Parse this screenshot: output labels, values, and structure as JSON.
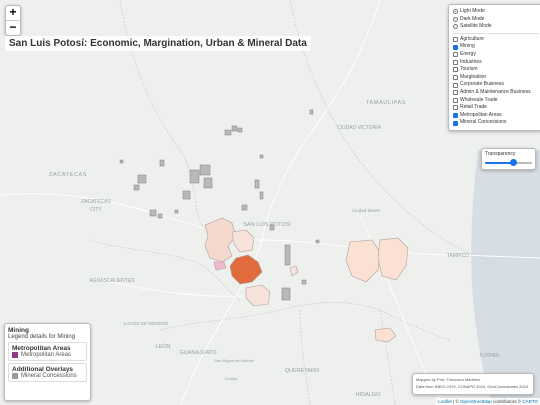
{
  "zoom": {
    "in_label": "+",
    "out_label": "−"
  },
  "title": "San Luis Potosí: Economic, Margination, Urban & Mineral Data",
  "layer_control": {
    "base_modes": [
      {
        "label": "Light Mode",
        "selected": true
      },
      {
        "label": "Dark Mode",
        "selected": false
      },
      {
        "label": "Satellite Mode",
        "selected": false
      }
    ],
    "overlays": [
      {
        "label": "Agriculture",
        "checked": false
      },
      {
        "label": "Mining",
        "checked": true
      },
      {
        "label": "Energy",
        "checked": false
      },
      {
        "label": "Industries",
        "checked": false
      },
      {
        "label": "Tourism",
        "checked": false
      },
      {
        "label": "Margination",
        "checked": false
      },
      {
        "label": "Corporate Business",
        "checked": false
      },
      {
        "label": "Admin & Maintenance Business",
        "checked": false
      },
      {
        "label": "Wholesale Trade",
        "checked": false
      },
      {
        "label": "Retail Trade",
        "checked": false
      },
      {
        "label": "Metropolitan Areas",
        "checked": true
      },
      {
        "label": "Mineral Concessions",
        "checked": true
      }
    ]
  },
  "transparency": {
    "label": "Transparency",
    "value": 0.6
  },
  "legend": {
    "title": "Mining",
    "subtitle": "Legend details for Mining",
    "sections": [
      {
        "heading": "Metropolitan Areas",
        "item": "Metropolitan Areas",
        "color": "#8e3b8e"
      },
      {
        "heading": "Additional Overlays",
        "item": "Mineral Concessions",
        "color": "#9a9a9a"
      }
    ]
  },
  "credits": {
    "line1": "Mapped by Prof. Francisco Martinez",
    "line2": "Data from INEGI 2019, CONAPO 2024, GeoConcesiones 2024"
  },
  "attribution": {
    "leaflet": "Leaflet",
    "sep": " | © ",
    "osm": "OpenStreetMap",
    "mid": " contributors © ",
    "carto": "CARTO"
  },
  "place_labels": [
    {
      "text": "TAMAULIPAS",
      "kind": "state"
    },
    {
      "text": "CIUDAD VICTORIA",
      "kind": "city"
    },
    {
      "text": "ZACATECAS",
      "kind": "state"
    },
    {
      "text": "ZACATECAS",
      "kind": "city"
    },
    {
      "text": "CITY",
      "kind": "city"
    },
    {
      "text": "SAN LUIS POTOSÍ",
      "kind": "city"
    },
    {
      "text": "Ciudad Mante",
      "kind": "town"
    },
    {
      "text": "TAMPICO",
      "kind": "city"
    },
    {
      "text": "AGUASCALIENTES",
      "kind": "city"
    },
    {
      "text": "LAGOS DE MORENO",
      "kind": "town"
    },
    {
      "text": "LEÓN",
      "kind": "city"
    },
    {
      "text": "GUANAJUATO",
      "kind": "state"
    },
    {
      "text": "QUERÉTARO",
      "kind": "state"
    },
    {
      "text": "TUXPAN",
      "kind": "city"
    },
    {
      "text": "HIDALGO",
      "kind": "state"
    },
    {
      "text": "San Miguel de Allende",
      "kind": "town"
    },
    {
      "text": "Celaya",
      "kind": "town"
    }
  ]
}
